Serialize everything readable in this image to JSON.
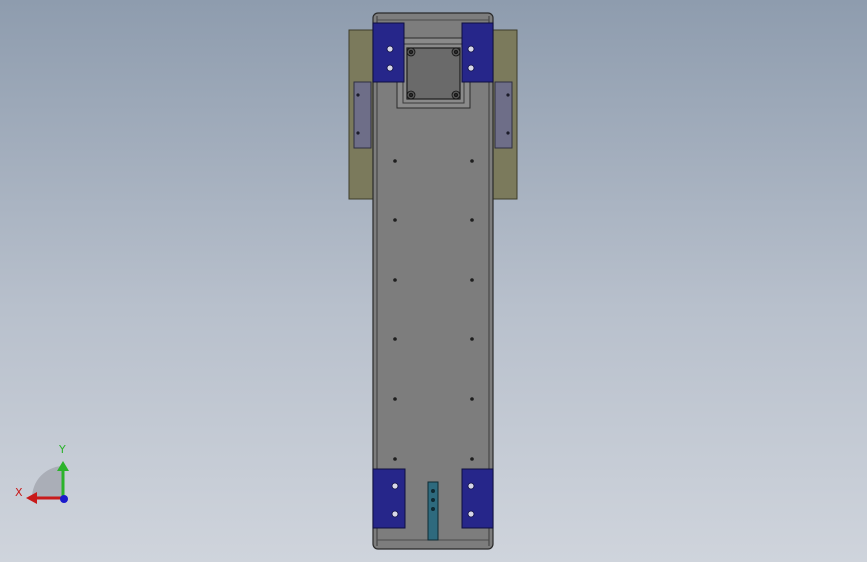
{
  "viewport": {
    "background_top": "#8e9cae",
    "background_bottom": "#cfd4dc"
  },
  "model": {
    "rail_color": "#7d7d7d",
    "mount_plate_color": "#7b7a5c",
    "motor_plate_color": "#26268a",
    "side_rail_color": "#6e6e88",
    "sensor_block_color": "#2e6a7e"
  },
  "triad": {
    "y_label": "Y",
    "x_label": "X",
    "y_color": "#2bb32b",
    "x_color": "#c81a1a",
    "z_color": "#1a1acc"
  }
}
